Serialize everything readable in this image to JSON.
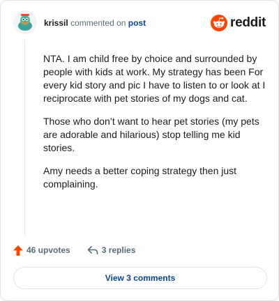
{
  "header": {
    "username": "krissil",
    "action_text": "commented on",
    "post_link": "post",
    "brand_name": "reddit"
  },
  "comment": {
    "paragraphs": [
      "NTA. I am child free by choice and surrounded by people with kids at work. My strategy has been For every kid story and pic I have to listen to or look at I reciprocate with pet stories of my dogs and cat.",
      "Those who don’t want to hear pet stories (my pets are adorable and hilarious) stop telling me kid stories.",
      "Amy needs a better coping strategy then just complaining."
    ]
  },
  "actions": {
    "upvotes": "46 upvotes",
    "replies": "3 replies"
  },
  "footer": {
    "view_comments": "View 3 comments"
  },
  "colors": {
    "reddit_orange": "#ff4500",
    "link_blue": "#0a449b",
    "muted": "#576f76"
  }
}
